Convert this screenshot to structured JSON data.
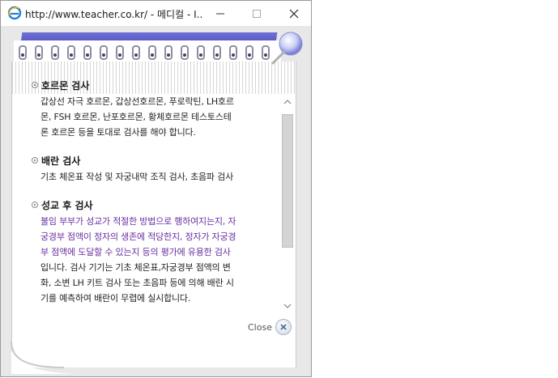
{
  "window": {
    "title": "http://www.teacher.co.kr/ - 메디컬 - I...",
    "minimize_label": "—",
    "maximize_label": "☐",
    "close_label": "✕"
  },
  "sections": [
    {
      "heading": "호르몬 검사",
      "lines": [
        "갑상선 자극 호르몬, 갑상선호르몬, 푸로락틴, LH호르",
        "몬, FSH 호르몬, 난포호르몬, 황체호르몬 테스토스테",
        "론 호르몬 등을 토대로 검사를 해야 합니다."
      ]
    },
    {
      "heading": "배란 검사",
      "lines": [
        "기초 체온표 작성 및 자궁내막 조직 검사, 초음파 검사"
      ]
    },
    {
      "heading": "성교 후 검사",
      "lines_purple": [
        "불임 부부가 성교가 적절한 방법으로 행하여지는지, 자",
        "궁경부 점액이 정자의 생존에 적당한지, 정자가 자궁경",
        "부 점액에 도달할 수 있는지 등의 평가에 유용한 검사"
      ],
      "lines": [
        "입니다. 검사 기기는 기초 체온표,자궁경부 점액의 변",
        "화, 소변 LH 키트 검사 또는 초음파 등에 의해 배란 시",
        "기를 예측하여 배란이 무렵에 실시합니다."
      ]
    }
  ],
  "scroll": {
    "up_icon": "chevron-up-icon",
    "down_icon": "chevron-down-icon"
  },
  "close_button": {
    "label": "Close",
    "icon": "x-icon"
  },
  "colors": {
    "accent_blue": "#4a4ac0",
    "purple_text": "#6a2ea0"
  }
}
